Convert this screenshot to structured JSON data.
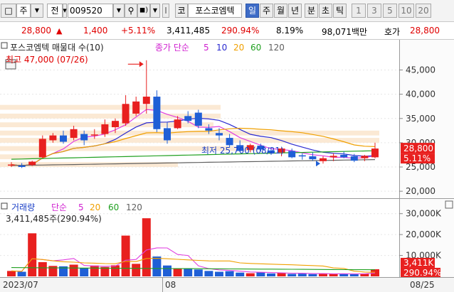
{
  "toolbar": {
    "period_type": "주",
    "prev_label": "전",
    "code": "009520",
    "code_badge": "코",
    "stock_name": "포스코엠텍",
    "tabs": [
      "일",
      "주",
      "월",
      "년",
      "분",
      "초",
      "틱"
    ],
    "active_tab": "일",
    "numbers": [
      "1",
      "3",
      "5",
      "10",
      "20"
    ]
  },
  "quote": {
    "price": "28,800",
    "change": "1,400",
    "change_pct": "+5.11%",
    "volume": "3,411,485",
    "volume_ratio": "290.94%",
    "turnover": "8.19%",
    "amount": "98,071백만",
    "ask_label": "호가",
    "ask_price": "28,800"
  },
  "price_panel": {
    "title": "포스코엠텍 매물대 수(10)",
    "ma_label": "종가 단순",
    "ma_periods": [
      "5",
      "10",
      "20",
      "60",
      "120"
    ],
    "high_label": "최고 47,000 (07/26)",
    "low_label": "최저 25,700 (08/21)",
    "y_ticks": [
      "45,000",
      "40,000",
      "35,000",
      "30,000",
      "25,000",
      "20,000"
    ],
    "current_price": "28,800",
    "current_pct": "5.11%"
  },
  "volume_panel": {
    "title": "거래량",
    "ma_label": "단순",
    "ma_periods": [
      "5",
      "20",
      "60",
      "120"
    ],
    "volume_text": "3,411,485주(290.94%)",
    "y_ticks": [
      "30,000K",
      "20,000K",
      "10,000K"
    ],
    "current_volume": "3,411K",
    "current_pct": "290.94%"
  },
  "x_axis": {
    "labels": [
      "2023/07",
      "08",
      "08/25"
    ]
  },
  "colors": {
    "up": "#e8201f",
    "down": "#1f5fd6",
    "ma5": "#e040e0",
    "ma10": "#2a2ad0",
    "ma20": "#f0a000",
    "ma60": "#20a020",
    "ma120": "#606060"
  },
  "chart_data": {
    "type": "candlestick",
    "ohlc": [
      [
        25500,
        26000,
        25000,
        25500
      ],
      [
        25300,
        25800,
        24800,
        25000
      ],
      [
        25400,
        26300,
        25200,
        26100
      ],
      [
        27000,
        31500,
        26800,
        30800
      ],
      [
        30500,
        32000,
        30000,
        31500
      ],
      [
        31500,
        32500,
        29800,
        30200
      ],
      [
        31000,
        33500,
        30500,
        32800
      ],
      [
        31800,
        32500,
        29500,
        30500
      ],
      [
        31500,
        32800,
        30800,
        31700
      ],
      [
        31800,
        34800,
        31200,
        33800
      ],
      [
        33200,
        35000,
        32000,
        34500
      ],
      [
        34000,
        39800,
        33500,
        38000
      ],
      [
        36000,
        39500,
        35500,
        38500
      ],
      [
        38000,
        47000,
        36000,
        39500
      ],
      [
        39500,
        40800,
        32200,
        32800
      ],
      [
        33000,
        34200,
        29800,
        30500
      ],
      [
        33000,
        35500,
        32800,
        34800
      ],
      [
        35500,
        36500,
        34000,
        34500
      ],
      [
        36200,
        36800,
        33000,
        33500
      ],
      [
        33000,
        33800,
        31800,
        32500
      ],
      [
        32000,
        33000,
        30500,
        31500
      ],
      [
        31000,
        31800,
        29000,
        29500
      ],
      [
        29500,
        30500,
        28200,
        28300
      ],
      [
        28500,
        29800,
        28000,
        29500
      ],
      [
        29400,
        29800,
        28200,
        28600
      ],
      [
        28400,
        29000,
        27500,
        27900
      ],
      [
        28000,
        29000,
        27200,
        28800
      ],
      [
        28300,
        28800,
        26800,
        27000
      ],
      [
        27400,
        27800,
        26500,
        27300
      ],
      [
        27200,
        28000,
        26300,
        26600
      ],
      [
        26200,
        27200,
        25700,
        26800
      ],
      [
        27000,
        27800,
        26200,
        27300
      ],
      [
        27500,
        28200,
        26800,
        27000
      ],
      [
        27200,
        27700,
        26000,
        26300
      ],
      [
        26800,
        27500,
        26200,
        27300
      ],
      [
        27000,
        30000,
        26800,
        28800
      ]
    ],
    "volume_k": [
      2600,
      2200,
      20600,
      6800,
      5000,
      4800,
      5600,
      4000,
      5200,
      4500,
      5300,
      19500,
      6000,
      27800,
      9500,
      5200,
      3800,
      3600,
      3300,
      2600,
      2200,
      2500,
      1800,
      1500,
      1900,
      1400,
      1700,
      1200,
      1300,
      1100,
      1400,
      1200,
      1300,
      1000,
      1200,
      3411
    ],
    "ylim": [
      19000,
      48000
    ],
    "volume_ylim": [
      0,
      35000
    ]
  }
}
